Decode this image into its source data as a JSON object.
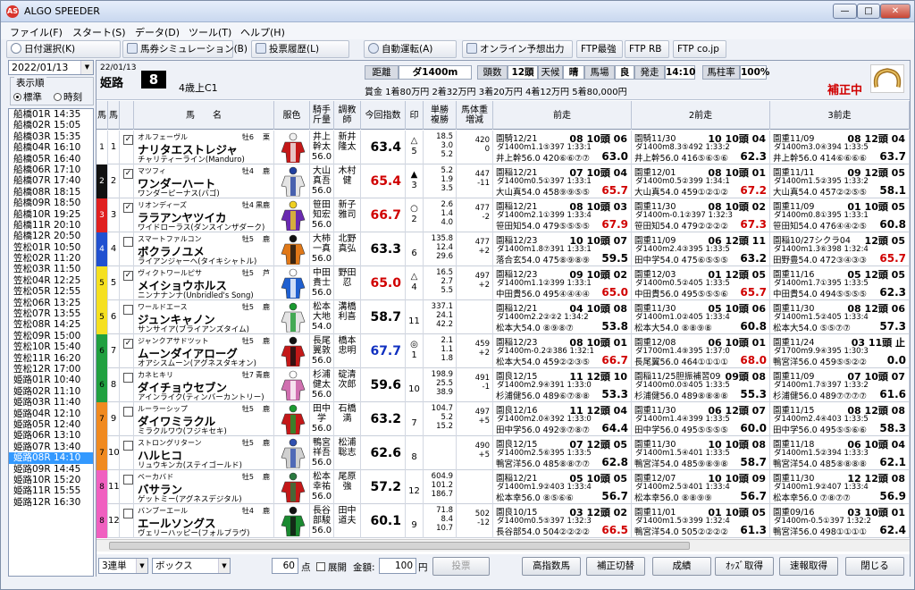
{
  "window": {
    "title": "ALGO SPEEDER",
    "app_icon": "AS"
  },
  "menu": [
    "ファイル(F)",
    "スタート(S)",
    "データ(D)",
    "ツール(T)",
    "ヘルプ(H)"
  ],
  "toolbar": {
    "date_select": "日付選択(K)",
    "bet_sim": "馬券シミュレーション(B)",
    "history": "投票履歴(L)",
    "auto_run": "自動運転(A)",
    "online": "オンライン予想出力",
    "ftp_best": "FTP最強",
    "ftp_rb": "FTP RB",
    "ftp_co": "FTP co.jp"
  },
  "left": {
    "date": "2022/01/13",
    "order_label": "表示順",
    "opt_standard": "標準",
    "opt_time": "時刻",
    "races": [
      "船橋01R 14:35",
      "船橋02R 15:05",
      "船橋03R 15:35",
      "船橋04R 16:10",
      "船橋05R 16:40",
      "船橋06R 17:10",
      "船橋07R 17:40",
      "船橋08R 18:15",
      "船橋09R 18:50",
      "船橋10R 19:25",
      "船橋11R 20:10",
      "船橋12R 20:50",
      "笠松01R 10:50",
      "笠松02R 11:20",
      "笠松03R 11:50",
      "笠松04R 12:25",
      "笠松05R 12:55",
      "笠松06R 13:25",
      "笠松07R 13:55",
      "笠松08R 14:25",
      "笠松09R 15:00",
      "笠松10R 15:40",
      "笠松11R 16:20",
      "笠松12R 17:00",
      "姫路01R 10:40",
      "姫路02R 11:10",
      "姫路03R 11:40",
      "姫路04R 12:10",
      "姫路05R 12:40",
      "姫路06R 13:10",
      "姫路07R 13:40",
      "姫路08R 14:10",
      "姫路09R 14:45",
      "姫路10R 15:20",
      "姫路11R 15:55",
      "姫路12R 16:30"
    ],
    "selected_index": 31
  },
  "race": {
    "date": "22/01/13",
    "course": "姫路",
    "race_no": "8",
    "class": "4歳上C1",
    "dist_label": "距離",
    "dist": "ダ1400m",
    "count_label": "頭数",
    "count": "12頭",
    "weather_label": "天候",
    "weather": "晴",
    "track_label": "馬場",
    "track": "良",
    "start_label": "発走",
    "start": "14:10",
    "rate_label": "馬柱率",
    "rate": "100%",
    "prize": "賞金 1着80万円  2着32万円  3着20万円  4着12万円  5着80,000円",
    "status": "補正中"
  },
  "columns": {
    "waku": "馬",
    "uma": "馬",
    "mark_chk": "",
    "name": "馬　　名",
    "silk": "服色",
    "jockey": "騎手\n斤量",
    "trainer": "調教\n師",
    "index": "今回指数",
    "mark": "印",
    "odds": "単勝\n複勝",
    "weight": "馬体重\n増減",
    "prev1": "前走",
    "prev2": "2前走",
    "prev3": "3前走"
  },
  "horses": [
    {
      "waku": "1",
      "uma": "1",
      "checked": true,
      "kana": "オルフェーヴル",
      "sex": "牡6",
      "hair": "栗",
      "name": "ナリタエストレジャ",
      "sire": "チャリティーライン(Manduro)",
      "jockey": "井上\n幹太\n56.0",
      "trainer": "新井\n隆太",
      "index": "63.4",
      "mark": "△\n5",
      "odds": "18.5\n3.0\n5.2",
      "weight": "420\n0",
      "p1": [
        "園騎12/21",
        "08 10頭 06",
        "ダ1400m1.1⑤397 1:33:1",
        "井上幹56.0 420⑥⑥⑦⑦",
        "63.0"
      ],
      "p2": [
        "園騎11/30",
        "10 10頭 04",
        "ダ1400m8.3⑤492 1:33:2",
        "井上幹56.0 416⑤⑥⑤⑥",
        "62.3"
      ],
      "p3": [
        "園重11/09",
        "08 12頭 04",
        "ダ1400m3.0④394 1:33:5",
        "井上幹56.0 414⑥⑥⑥⑥",
        "63.7"
      ]
    },
    {
      "waku": "2",
      "uma": "2",
      "checked": true,
      "kana": "マツフィ",
      "sex": "牡4",
      "hair": "鹿",
      "name": "ワンダーハート",
      "sire": "ワンダーピーナス(バゴ)",
      "jockey": "大山\n真吾\n56.0",
      "trainer": "木村\n健",
      "index": "65.4",
      "mark": "▲\n3",
      "odds": "5.2\n1.9\n3.5",
      "weight": "447\n-11",
      "p1": [
        "園稲12/21",
        "07 10頭 04",
        "ダ1400m0.5①397 1:33:1",
        "大山真54.0 458⑨⑨⑤⑤",
        "65.7"
      ],
      "p2": [
        "園重12/01",
        "08 10頭 01",
        "ダ1400m0.5②399 1:34:1",
        "大山真54.0 459①②①②",
        "67.2"
      ],
      "p3": [
        "園重11/11",
        "09 12頭 05",
        "ダ1400m1.5②395 1:33:2",
        "大山真54.0 457②②⑤⑤",
        "58.1"
      ]
    },
    {
      "waku": "3",
      "uma": "3",
      "checked": true,
      "kana": "リオンディーズ",
      "sex": "牡4",
      "hair": "黒鹿",
      "name": "ララアンヤツイカ",
      "sire": "ワイドローラス(ダンスインザダーク)",
      "jockey": "笹田\n知宏\n56.0",
      "trainer": "新子\n雅司",
      "index": "66.7",
      "mark": "○\n2",
      "odds": "2.6\n1.4\n4.0",
      "weight": "477\n-2",
      "p1": [
        "園稲12/21",
        "08 10頭 03",
        "ダ1400m2.1①399 1:33:4",
        "笹田知54.0 479⑤⑤⑤⑤",
        "67.9"
      ],
      "p2": [
        "園重11/30",
        "08 10頭 02",
        "ダ1400m-0.1②397 1:32:3",
        "笹田知54.0 479②②②②",
        "67.3"
      ],
      "p3": [
        "園重11/09",
        "01 10頭 05",
        "ダ1400m0.8①395 1:33:1",
        "笹田知54.0 476④④②⑤",
        "60.8"
      ]
    },
    {
      "waku": "4",
      "uma": "4",
      "checked": false,
      "kana": "スマートファルコン",
      "sex": "牡5",
      "hair": "鹿",
      "name": "ボクラノユメ",
      "sire": "ライアンジャーヘ(タイキシャトル)",
      "jockey": "大柿\n一真\n56.0",
      "trainer": "北野\n真弘",
      "index": "63.3",
      "mark": "\n6",
      "odds": "135.8\n12.4\n29.6",
      "weight": "477\n+2",
      "p1": [
        "園稲12/23",
        "10 10頭 07",
        "ダ1400m1.8⑦391 1:33:1",
        "落合玄54.0 475⑧⑨⑧⑨",
        "59.5"
      ],
      "p2": [
        "園重11/09",
        "06 12頭 11",
        "ダ1400m2.4③395 1:33:5",
        "田中学54.0 475⑥⑤⑤⑤",
        "63.2"
      ],
      "p3": [
        "園稲10/27シクラ04",
        "12頭 05",
        "ダ1400m1.3⑥398 1:32:4",
        "田野豊54.0 472③④③③",
        "65.7"
      ]
    },
    {
      "waku": "5",
      "uma": "5",
      "checked": true,
      "kana": "ヴィクトワールピサ",
      "sex": "牡5",
      "hair": "芦",
      "name": "メイショウホルス",
      "sire": "ニンナナンナ(Unbridled's Song)",
      "jockey": "中田\n貴士\n56.0",
      "trainer": "野田\n忍",
      "index": "65.0",
      "mark": "△\n4",
      "odds": "16.5\n2.7\n5.5",
      "weight": "497\n+2",
      "p1": [
        "園稲12/23",
        "09 10頭 02",
        "ダ1400m1.1②399 1:33:1",
        "中田貴56.0 495④④④④",
        "65.0"
      ],
      "p2": [
        "園重12/03",
        "01 12頭 05",
        "ダ1400m0.5②405 1:33:5",
        "中田貴56.0 495⑤⑤⑤⑥",
        "65.7"
      ],
      "p3": [
        "園重11/16",
        "05 12頭 05",
        "ダ1400m1.7①395 1:33:5",
        "中田貴54.0 494⑤⑤⑤⑤",
        "62.3"
      ]
    },
    {
      "waku": "5",
      "uma": "6",
      "checked": false,
      "kana": "ワールドエース",
      "sex": "牡5",
      "hair": "鹿",
      "name": "ジュンキャノン",
      "sire": "サンサイア(ブライアンズタイム)",
      "jockey": "松本\n大地\n54.0",
      "trainer": "溝橋\n利喜",
      "index": "58.7",
      "mark": "\n11",
      "odds": "337.1\n24.1\n42.2",
      "weight": "",
      "p1": [
        "園稲12/21",
        "04 10頭 08",
        "ダ1400m2.2②②2 1:34:2",
        "松本大54.0 ⑧⑨⑧⑦",
        "53.8"
      ],
      "p2": [
        "園重11/30",
        "05 10頭 06",
        "ダ1400m1.0②405 1:33:4",
        "松本大54.0 ⑧⑧⑨⑧",
        "60.8"
      ],
      "p3": [
        "園重11/30",
        "08 12頭 06",
        "ダ1400m1.5②405 1:33:4",
        "松本大54.0 ⑤⑤⑦⑦",
        "57.3"
      ]
    },
    {
      "waku": "6",
      "uma": "7",
      "checked": true,
      "kana": "ジャンクアサドツット",
      "sex": "牡5",
      "hair": "鹿",
      "name": "ムーンダイアローグ",
      "sire": "オアシスムーン(アグネスタキオン)",
      "jockey": "長尾\n翼敦\n56.0",
      "trainer": "橋本\n忠明",
      "index": "67.7",
      "mark": "◎\n1",
      "odds": "2.1\n1.1\n1.8",
      "weight": "459\n+2",
      "p1": [
        "園稲12/23",
        "08 10頭 01",
        "ダ1400m-0.2②386 1:32:1",
        "松本大54.0 459②②③⑤",
        "66.7"
      ],
      "p2": [
        "園重12/08",
        "06 10頭 01",
        "ダ1700m1.4⑨395 1:37:0",
        "長尾翼56.0 464①①①①",
        "68.0"
      ],
      "p3": [
        "園重11/24",
        "03 11頭 止",
        "ダ1700m9.9④395 1:30:3",
        "鴨宮洋56.0 459⑤⑤②②",
        "0.0"
      ]
    },
    {
      "waku": "6",
      "uma": "8",
      "checked": false,
      "kana": "カネヒキリ",
      "sex": "牡7",
      "hair": "青鹿",
      "name": "ダイチョウセブン",
      "sire": "アインライク(ティンバーカントリー)",
      "jockey": "杉浦\n健太\n56.0",
      "trainer": "碇清\n次郎",
      "index": "59.6",
      "mark": "\n10",
      "odds": "198.9\n25.5\n38.9",
      "weight": "491\n-1",
      "p1": [
        "園良12/15",
        "11 12頭 10",
        "ダ1400m2.9④391 1:33:0",
        "杉浦健56.0 489⑥⑦⑧⑧",
        "53.3"
      ],
      "p2": [
        "園稲11/25胆振補習09",
        "09頭 08",
        "ダ1400m0.0⑤405 1:33:5",
        "杉浦健56.0 489⑧⑧⑧⑧",
        "55.3"
      ],
      "p3": [
        "園重11/09",
        "07 10頭 07",
        "ダ1400m1.7⑤397 1:33:2",
        "杉浦健56.0 489⑦⑦⑦⑦",
        "61.6"
      ]
    },
    {
      "waku": "7",
      "uma": "9",
      "checked": false,
      "kana": "ルーラーシップ",
      "sex": "牡5",
      "hair": "鹿",
      "name": "ダイワミラクル",
      "sire": "ミラクルワウ(フジキセキ)",
      "jockey": "田中\n学\n56.0",
      "trainer": "石橋\n満",
      "index": "63.2",
      "mark": "\n7",
      "odds": "104.7\n5.2\n15.2",
      "weight": "497\n+5",
      "p1": [
        "園良12/16",
        "11 12頭 04",
        "ダ1400m2.0④392 1:33:0",
        "田中学56.0 492⑨⑦⑧⑦",
        "64.4"
      ],
      "p2": [
        "園重11/30",
        "06 12頭 07",
        "ダ1400m1.4④399 1:33:5",
        "田中学56.0 495⑤⑤⑤⑤",
        "60.0"
      ],
      "p3": [
        "園重11/15",
        "08 12頭 08",
        "ダ1400m2.4④403 1:33:5",
        "田中学56.0 495⑤⑤⑥⑥",
        "58.3"
      ]
    },
    {
      "waku": "7",
      "uma": "10",
      "checked": false,
      "kana": "ストロングリターン",
      "sex": "牡5",
      "hair": "鹿",
      "name": "ハルヒコ",
      "sire": "リュウキンカ(ステイゴールド)",
      "jockey": "鴨宮\n祥吾\n56.0",
      "trainer": "松浦\n聡志",
      "index": "62.6",
      "mark": "\n8",
      "odds": "",
      "weight": "490\n+5",
      "p1": [
        "園良12/15",
        "07 12頭 05",
        "ダ1400m2.5⑥395 1:33:5",
        "鴨宮洋56.0 485⑧⑧⑦⑦",
        "62.8"
      ],
      "p2": [
        "園重11/30",
        "10 10頭 08",
        "ダ1400m1.5④401 1:33:5",
        "鴨宮洋54.0 485⑨⑧⑨⑧",
        "58.7"
      ],
      "p3": [
        "園重11/18",
        "06 10頭 04",
        "ダ1400m1.5②394 1:33:3",
        "鴨宮洋54.0 485⑧⑧⑧⑧",
        "62.1"
      ]
    },
    {
      "waku": "8",
      "uma": "11",
      "checked": false,
      "kana": "ベーカバド",
      "sex": "牡5",
      "hair": "鹿",
      "name": "バサラン",
      "sire": "ゲットミー(アグネスデジタル)",
      "jockey": "松本\n幸祐\n56.0",
      "trainer": "尾原\n強",
      "index": "57.2",
      "mark": "\n12",
      "odds": "604.9\n101.2\n186.7",
      "weight": "",
      "p1": [
        "園稲12/21",
        "05 10頭 05",
        "ダ1400m1.9②403 1:33:4",
        "松本幸56.0 ⑧⑤⑥⑥",
        "56.7"
      ],
      "p2": [
        "園重12/07",
        "10 10頭 09",
        "ダ1400m2.5③401 1:33:4",
        "松本幸56.0 ⑧⑧⑨⑨",
        "56.7"
      ],
      "p3": [
        "園重11/30",
        "12 12頭 08",
        "ダ1400m1.9②407 1:33:4",
        "松本幸56.0 ⑦⑧⑦⑦",
        "56.9"
      ]
    },
    {
      "waku": "8",
      "uma": "12",
      "checked": false,
      "kana": "バンブーエール",
      "sex": "牡4",
      "hair": "鹿",
      "name": "エールソングス",
      "sire": "ヴェリーハッピー(フォルブラヴ)",
      "jockey": "長谷\n部駿\n56.0",
      "trainer": "田中\n道夫",
      "index": "60.1",
      "mark": "\n9",
      "odds": "71.8\n8.4\n10.7",
      "weight": "502\n-12",
      "p1": [
        "園良10/15",
        "03 12頭 02",
        "ダ1400m0.5⑤397 1:32:3",
        "長谷部54.0 504②②②②",
        "66.5"
      ],
      "p2": [
        "園重11/01",
        "01 10頭 05",
        "ダ1400m1.5③399 1:32:4",
        "鴨宮洋54.0 505②②②②",
        "61.3"
      ],
      "p3": [
        "園重09/16",
        "03 10頭 01",
        "ダ1400m-0.5①397 1:32:2",
        "鴨宮洋56.0 498①①①①",
        "62.4"
      ]
    }
  ],
  "waku_colors": {
    "1": "#ffffff",
    "2": "#111111",
    "3": "#e02020",
    "4": "#2050d0",
    "5": "#f5e020",
    "6": "#20a040",
    "7": "#f08a20",
    "8": "#f060c0"
  },
  "bottom": {
    "bet_type": "3連単",
    "method": "ボックス",
    "points": "60",
    "points_unit": "点",
    "expand": "展開",
    "amount_label": "金額:",
    "amount": "100",
    "amount_unit": "円",
    "vote": "投票",
    "high_index": "高指数馬",
    "hosei_toggle": "補正切替",
    "result": "成績",
    "odds": "ｵｯｽﾞ取得",
    "flash": "速報取得",
    "close": "閉じる"
  }
}
